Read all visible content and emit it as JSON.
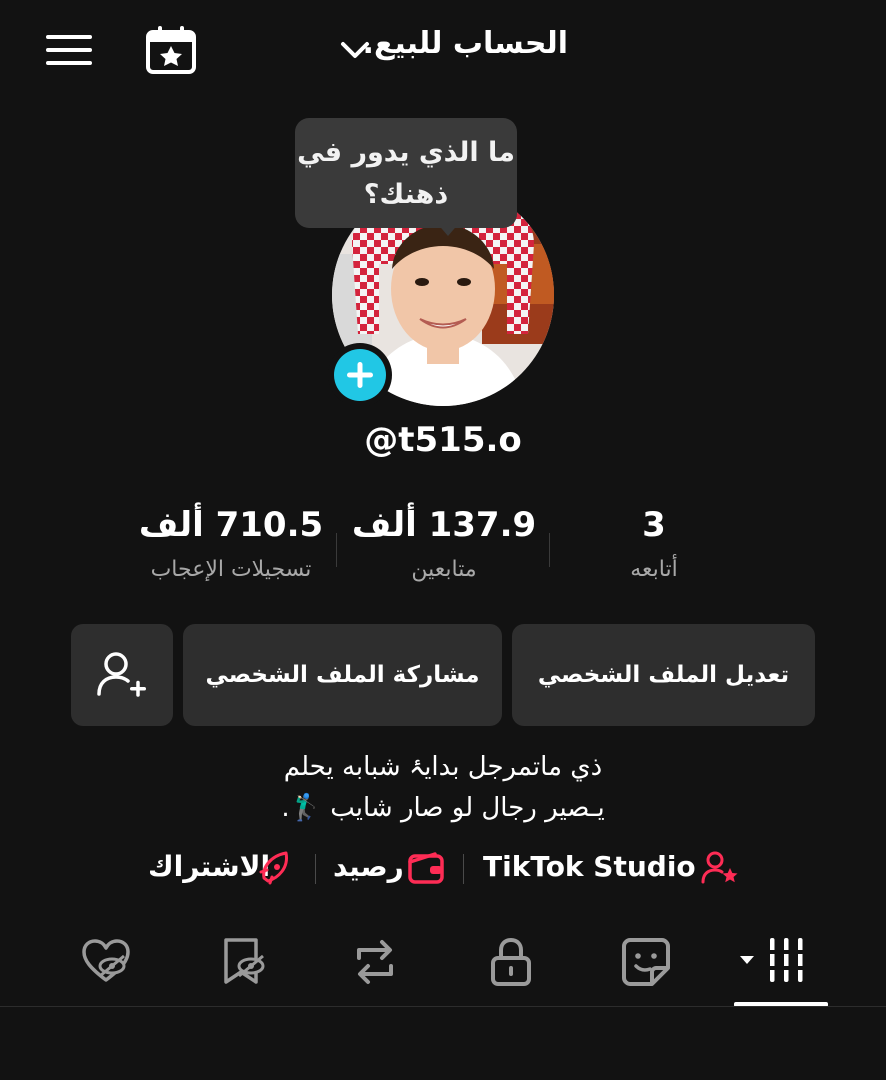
{
  "header": {
    "title": "الحساب للبيع.",
    "menu_icon": "hamburger-menu-icon",
    "calendar_icon": "calendar-star-icon",
    "dropdown_icon": "chevron-down-icon"
  },
  "bubble": {
    "line1": "ما الذي يدور في",
    "line2": "ذهنك؟"
  },
  "profile": {
    "username": "@t515.o",
    "add_avatar_icon": "plus-icon"
  },
  "stats": {
    "following": {
      "value": "3",
      "label": "أتابعه"
    },
    "followers": {
      "value": "137.9 ألف",
      "label": "متابعين"
    },
    "likes": {
      "value": "710.5 ألف",
      "label": "تسجيلات الإعجاب"
    }
  },
  "buttons": {
    "edit_profile": "تعديل الملف الشخصي",
    "share_profile": "مشاركة الملف الشخصي",
    "add_friend_icon": "add-user-icon"
  },
  "bio": {
    "line1": "ذي ماتمرجل بدايۂ شبابه يحلم",
    "line2": "يـصير رجال لو صار شايب 🏌🏻‍♂️."
  },
  "links": {
    "studio": "TikTok Studio",
    "balance": "رصيد",
    "subscription": "الاشتراك"
  },
  "colors": {
    "background": "#121212",
    "accent_red": "#fe2c55",
    "avatar_plus": "#21c7e5",
    "button_bg": "#2e2e2e",
    "muted_text": "#a8a8a8"
  },
  "tabs": [
    {
      "icon": "videos-grid-icon",
      "active": true
    },
    {
      "icon": "story-sticker-icon",
      "active": false
    },
    {
      "icon": "lock-icon",
      "active": false
    },
    {
      "icon": "repost-icon",
      "active": false
    },
    {
      "icon": "bookmark-hidden-icon",
      "active": false
    },
    {
      "icon": "liked-hidden-icon",
      "active": false
    }
  ]
}
